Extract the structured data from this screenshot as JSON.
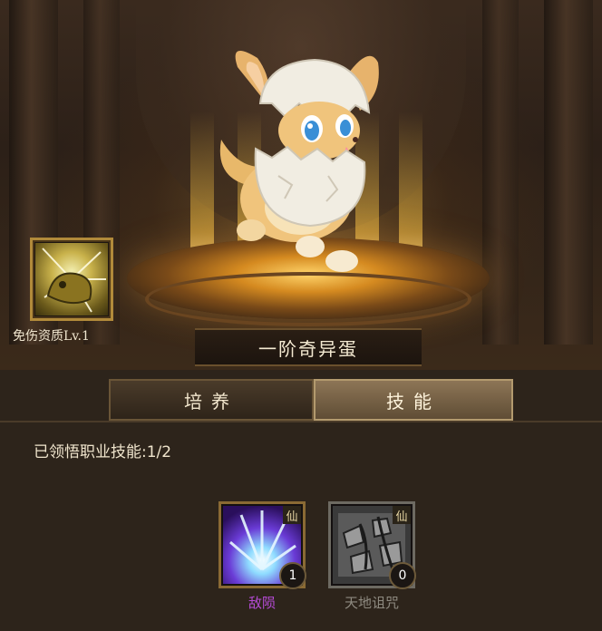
{
  "pet": {
    "name": "一阶奇异蛋"
  },
  "quality_badge": {
    "label": "免伤资质Lv.1",
    "icon": "golden-beast-icon"
  },
  "tabs": [
    {
      "label": "培养",
      "active": false
    },
    {
      "label": "技能",
      "active": true
    }
  ],
  "skills_panel": {
    "learned_text": "已领悟职业技能:1/2",
    "skills": [
      {
        "name": "敌陨",
        "level": "1",
        "badge": "仙",
        "icon": "purple-burst-skill-icon",
        "unlocked": true,
        "name_color": "#b54bd6"
      },
      {
        "name": "天地诅咒",
        "level": "0",
        "badge": "仙",
        "icon": "cursed-ground-skill-icon",
        "unlocked": false,
        "name_color": "#8e8a80"
      }
    ]
  },
  "colors": {
    "frame_gold": "#b18a3a",
    "active_tab": "#8d7556",
    "panel_bg": "#2d241b"
  }
}
